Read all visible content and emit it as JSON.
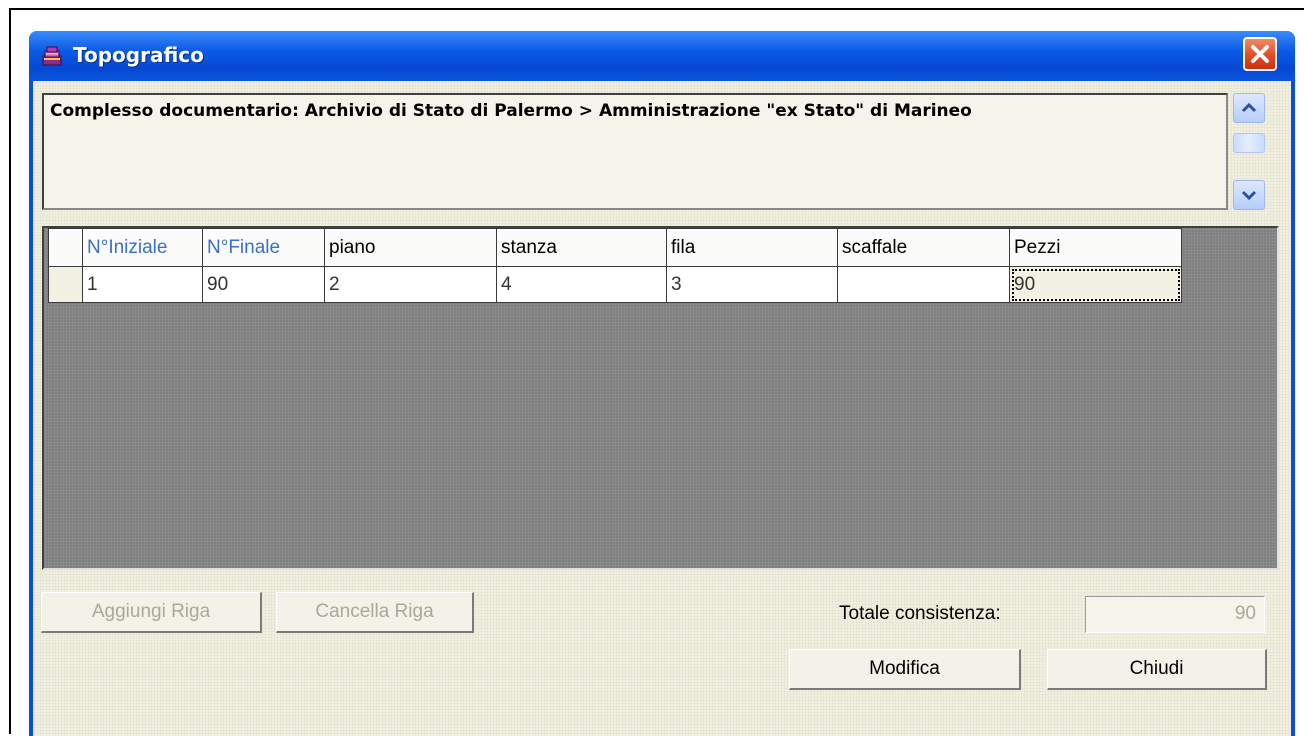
{
  "window": {
    "title": "Topografico",
    "icon": "books-icon",
    "close_icon": "close-icon"
  },
  "path": {
    "text": "Complesso documentario: Archivio di Stato di Palermo > Amministrazione \"ex Stato\" di Marineo"
  },
  "grid": {
    "columns": [
      "N°Iniziale",
      "N°Finale",
      "piano",
      "stanza",
      "fila",
      "scaffale",
      "Pezzi"
    ],
    "rows": [
      [
        "1",
        "90",
        "2",
        "4",
        "3",
        "",
        "90"
      ]
    ]
  },
  "buttons": {
    "add_row": "Aggiungi Riga",
    "delete_row": "Cancella Riga",
    "modify": "Modifica",
    "close": "Chiudi"
  },
  "total": {
    "label": "Totale consistenza:",
    "value": "90"
  },
  "colors": {
    "titlebar": "#0a5ae6",
    "header_link": "#3b6fc9",
    "close_button": "#e0461f"
  }
}
